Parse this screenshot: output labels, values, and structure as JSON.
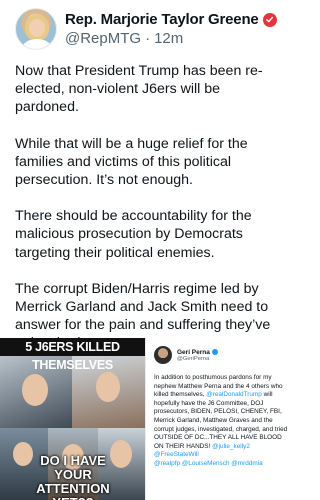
{
  "author": {
    "name": "Rep. Marjorie Taylor Greene",
    "handle": "@RepMTG",
    "separator": "·",
    "time": "12m"
  },
  "tweet": {
    "paragraphs": [
      "Now that President Trump has been re-elected, non-violent J6ers will be pardoned.",
      "While that will be a huge relief for the families and victims of this political persecution. It’s not enough.",
      "There should be accountability for the malicious prosecution by Democrats targeting their political enemies.",
      "The corrupt Biden/Harris regime led by Merrick Garland and Jack Smith need to answer for the pain and suffering they’ve unleashed."
    ]
  },
  "media": {
    "collage_top_text": "5 J6ERS KILLED THEMSELVES",
    "collage_bottom_text": "DO I HAVE YOUR ATTENTION YET??"
  },
  "quoted": {
    "name": "Geri Perna",
    "handle": "@GeriPerna",
    "text_part1": "In addition to posthumous pardons for my nephew Matthew Perna and the 4 others who killed themselves, ",
    "mention1": "@realDonaldTrump",
    "text_part2": " will hopefully have the J6 Committee, DOJ prosecutors, BIDEN, PELOSI, CHENEY, FBI, Merrick Garland, Matthew Graves and the corrupt judges, investigated, charged, and tried OUTSIDE OF DC...THEY ALL HAVE BLOOD ON THEIR HANDS! ",
    "mention2": "@julie_kelly2 @FreeStateWill",
    "mention3": "@realpfp @LouiseMensch @mrddmia"
  }
}
